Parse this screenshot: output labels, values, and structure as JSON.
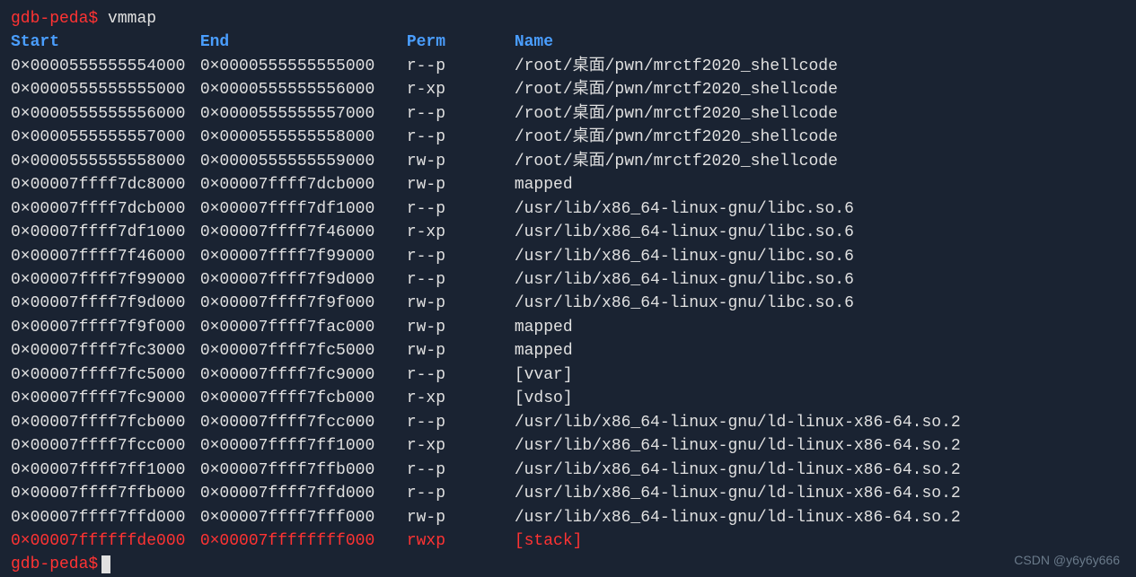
{
  "prompt": {
    "text": "gdb-peda",
    "dollar": "$",
    "command": "vmmap"
  },
  "header": {
    "start": "Start",
    "end": "End",
    "perm": "Perm",
    "name": "Name"
  },
  "rows": [
    {
      "start": "0×0000555555554000",
      "end": "0×0000555555555000",
      "perm": "r--p",
      "name": "/root/桌面/pwn/mrctf2020_shellcode",
      "red": false
    },
    {
      "start": "0×0000555555555000",
      "end": "0×0000555555556000",
      "perm": "r-xp",
      "name": "/root/桌面/pwn/mrctf2020_shellcode",
      "red": false
    },
    {
      "start": "0×0000555555556000",
      "end": "0×0000555555557000",
      "perm": "r--p",
      "name": "/root/桌面/pwn/mrctf2020_shellcode",
      "red": false
    },
    {
      "start": "0×0000555555557000",
      "end": "0×0000555555558000",
      "perm": "r--p",
      "name": "/root/桌面/pwn/mrctf2020_shellcode",
      "red": false
    },
    {
      "start": "0×0000555555558000",
      "end": "0×0000555555559000",
      "perm": "rw-p",
      "name": "/root/桌面/pwn/mrctf2020_shellcode",
      "red": false
    },
    {
      "start": "0×00007ffff7dc8000",
      "end": "0×00007ffff7dcb000",
      "perm": "rw-p",
      "name": "mapped",
      "red": false
    },
    {
      "start": "0×00007ffff7dcb000",
      "end": "0×00007ffff7df1000",
      "perm": "r--p",
      "name": "/usr/lib/x86_64-linux-gnu/libc.so.6",
      "red": false
    },
    {
      "start": "0×00007ffff7df1000",
      "end": "0×00007ffff7f46000",
      "perm": "r-xp",
      "name": "/usr/lib/x86_64-linux-gnu/libc.so.6",
      "red": false
    },
    {
      "start": "0×00007ffff7f46000",
      "end": "0×00007ffff7f99000",
      "perm": "r--p",
      "name": "/usr/lib/x86_64-linux-gnu/libc.so.6",
      "red": false
    },
    {
      "start": "0×00007ffff7f99000",
      "end": "0×00007ffff7f9d000",
      "perm": "r--p",
      "name": "/usr/lib/x86_64-linux-gnu/libc.so.6",
      "red": false
    },
    {
      "start": "0×00007ffff7f9d000",
      "end": "0×00007ffff7f9f000",
      "perm": "rw-p",
      "name": "/usr/lib/x86_64-linux-gnu/libc.so.6",
      "red": false
    },
    {
      "start": "0×00007ffff7f9f000",
      "end": "0×00007ffff7fac000",
      "perm": "rw-p",
      "name": "mapped",
      "red": false
    },
    {
      "start": "0×00007ffff7fc3000",
      "end": "0×00007ffff7fc5000",
      "perm": "rw-p",
      "name": "mapped",
      "red": false
    },
    {
      "start": "0×00007ffff7fc5000",
      "end": "0×00007ffff7fc9000",
      "perm": "r--p",
      "name": "[vvar]",
      "red": false
    },
    {
      "start": "0×00007ffff7fc9000",
      "end": "0×00007ffff7fcb000",
      "perm": "r-xp",
      "name": "[vdso]",
      "red": false
    },
    {
      "start": "0×00007ffff7fcb000",
      "end": "0×00007ffff7fcc000",
      "perm": "r--p",
      "name": "/usr/lib/x86_64-linux-gnu/ld-linux-x86-64.so.2",
      "red": false
    },
    {
      "start": "0×00007ffff7fcc000",
      "end": "0×00007ffff7ff1000",
      "perm": "r-xp",
      "name": "/usr/lib/x86_64-linux-gnu/ld-linux-x86-64.so.2",
      "red": false
    },
    {
      "start": "0×00007ffff7ff1000",
      "end": "0×00007ffff7ffb000",
      "perm": "r--p",
      "name": "/usr/lib/x86_64-linux-gnu/ld-linux-x86-64.so.2",
      "red": false
    },
    {
      "start": "0×00007ffff7ffb000",
      "end": "0×00007ffff7ffd000",
      "perm": "r--p",
      "name": "/usr/lib/x86_64-linux-gnu/ld-linux-x86-64.so.2",
      "red": false
    },
    {
      "start": "0×00007ffff7ffd000",
      "end": "0×00007ffff7fff000",
      "perm": "rw-p",
      "name": "/usr/lib/x86_64-linux-gnu/ld-linux-x86-64.so.2",
      "red": false
    },
    {
      "start": "0×00007ffffffde000",
      "end": "0×00007ffffffff000",
      "perm": "rwxp",
      "name": "[stack]",
      "red": true
    }
  ],
  "watermark": "CSDN @y6y6y666"
}
